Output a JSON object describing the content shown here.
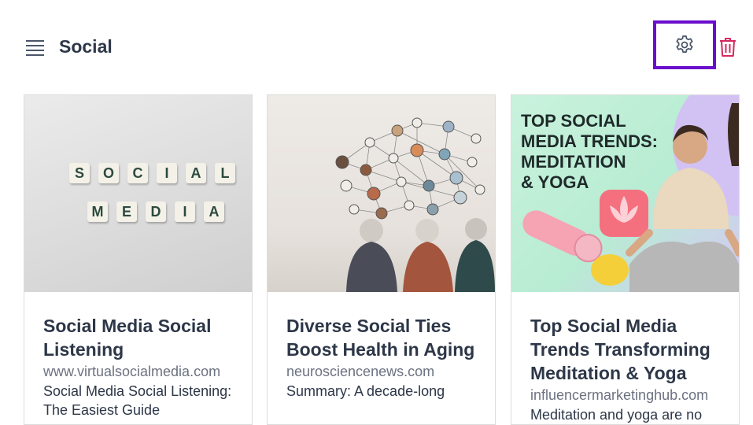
{
  "header": {
    "title": "Social",
    "menu_icon": "hamburger-menu-icon",
    "settings_icon": "gear-icon",
    "delete_icon": "trash-icon",
    "highlight_color": "#6a0dcc",
    "delete_color": "#d6285e"
  },
  "cards": [
    {
      "title": "Social Media Social Listening",
      "domain": "www.virtualsocialmedia.com",
      "description": "Social Media Social Listening: The Easiest Guide",
      "image": {
        "kind": "photo-letter-tiles",
        "tile_rows": [
          "SOCIAL",
          "MEDIA"
        ]
      }
    },
    {
      "title": "Diverse Social Ties Boost Health in Aging",
      "domain": "neurosciencenews.com",
      "description": "Summary: A decade-long",
      "image": {
        "kind": "photo-elderly-people-network"
      }
    },
    {
      "title": "Top Social Media Trends Transforming Meditation & Yoga",
      "domain": "influencermarketinghub.com",
      "description": "Meditation and yoga are no",
      "image": {
        "kind": "illustration-meditation",
        "headline_lines": [
          "TOP SOCIAL",
          "MEDIA TRENDS:",
          "MEDITATION",
          "& YOGA"
        ]
      }
    }
  ]
}
